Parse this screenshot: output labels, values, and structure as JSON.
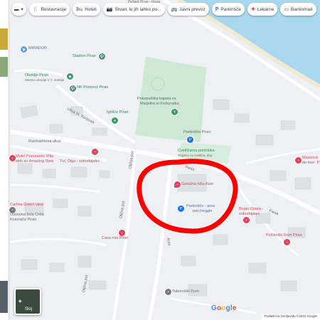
{
  "toolbar": {
    "chips": [
      {
        "label": "Restavracije",
        "icon": "fork-knife-icon"
      },
      {
        "label": "Hoteli",
        "icon": "bed-icon"
      },
      {
        "label": "Stvari, ki jih lahko po...",
        "icon": "camera-icon"
      },
      {
        "label": "Javni prevoz",
        "icon": "bus-icon"
      },
      {
        "label": "Parkirišče",
        "icon": "parking-icon"
      },
      {
        "label": "Lekarne",
        "icon": "pharmacy-icon"
      },
      {
        "label": "Bankomati",
        "icon": "atm-icon"
      }
    ]
  },
  "labels": {
    "top": "Pešpot Piran - Fiesa",
    "mirador": "MIRADOR",
    "stadion": "Stadion Piran",
    "obzidje": "Obzidje Piran",
    "obzidje_sub": "Mestno obzidje iz 7. stoletja",
    "nk": "NK Portorož Piran",
    "kapela": "Pokopališka kapela sv.",
    "kapela2": "Marjetke in Fortunatka",
    "igrisce": "Igrišče Piran",
    "parkirisce1": "Parkirišče Piran",
    "oljcni": "Cvetličarna portoluka",
    "oljcni2": "Trajnica za cvetlice, dop",
    "vilisk": "Ulica IX. Korpusa",
    "razmarinova": "Razmarinova ulica",
    "motel": "Motel Panoramic Villa",
    "motel2": "with an Amazing View",
    "tuc": "Tuč Olga - sobodajalec",
    "garaza": "Garažna hiša Arze",
    "parkirisce2": "Parkirišče - area",
    "parkirisce2b": "parcheggio",
    "bojan": "Bojan Opara -",
    "bojan2": "sobodajalec",
    "maison": "Maison b",
    "maison2": "de mer- P",
    "dom": "Počitniški Dom Piran",
    "casa": "Casa mia Piran",
    "tabor": "Taborniški Dom",
    "sola": "Osnovna šola Cirila",
    "sola2": "Kosmača Piran",
    "cartina": "Cartina Green view",
    "fiesa1": "Fiesa",
    "fiesa2": "Fiesa",
    "arze": "Arze",
    "olive": "Oljčna pot",
    "olive2": "Oljčna pot",
    "oljcna3": "Oljčna pot",
    "skyview": "Sloj",
    "google": "Google",
    "footer": "Podatki na zemljevidu ©2023 Google"
  },
  "colors": {
    "water": "#a9d8ee",
    "park": "#cde8d3",
    "road": "#ffffff",
    "building": "#e3e6ea",
    "highlight": "#ff0000",
    "pin": "#e0445a"
  }
}
